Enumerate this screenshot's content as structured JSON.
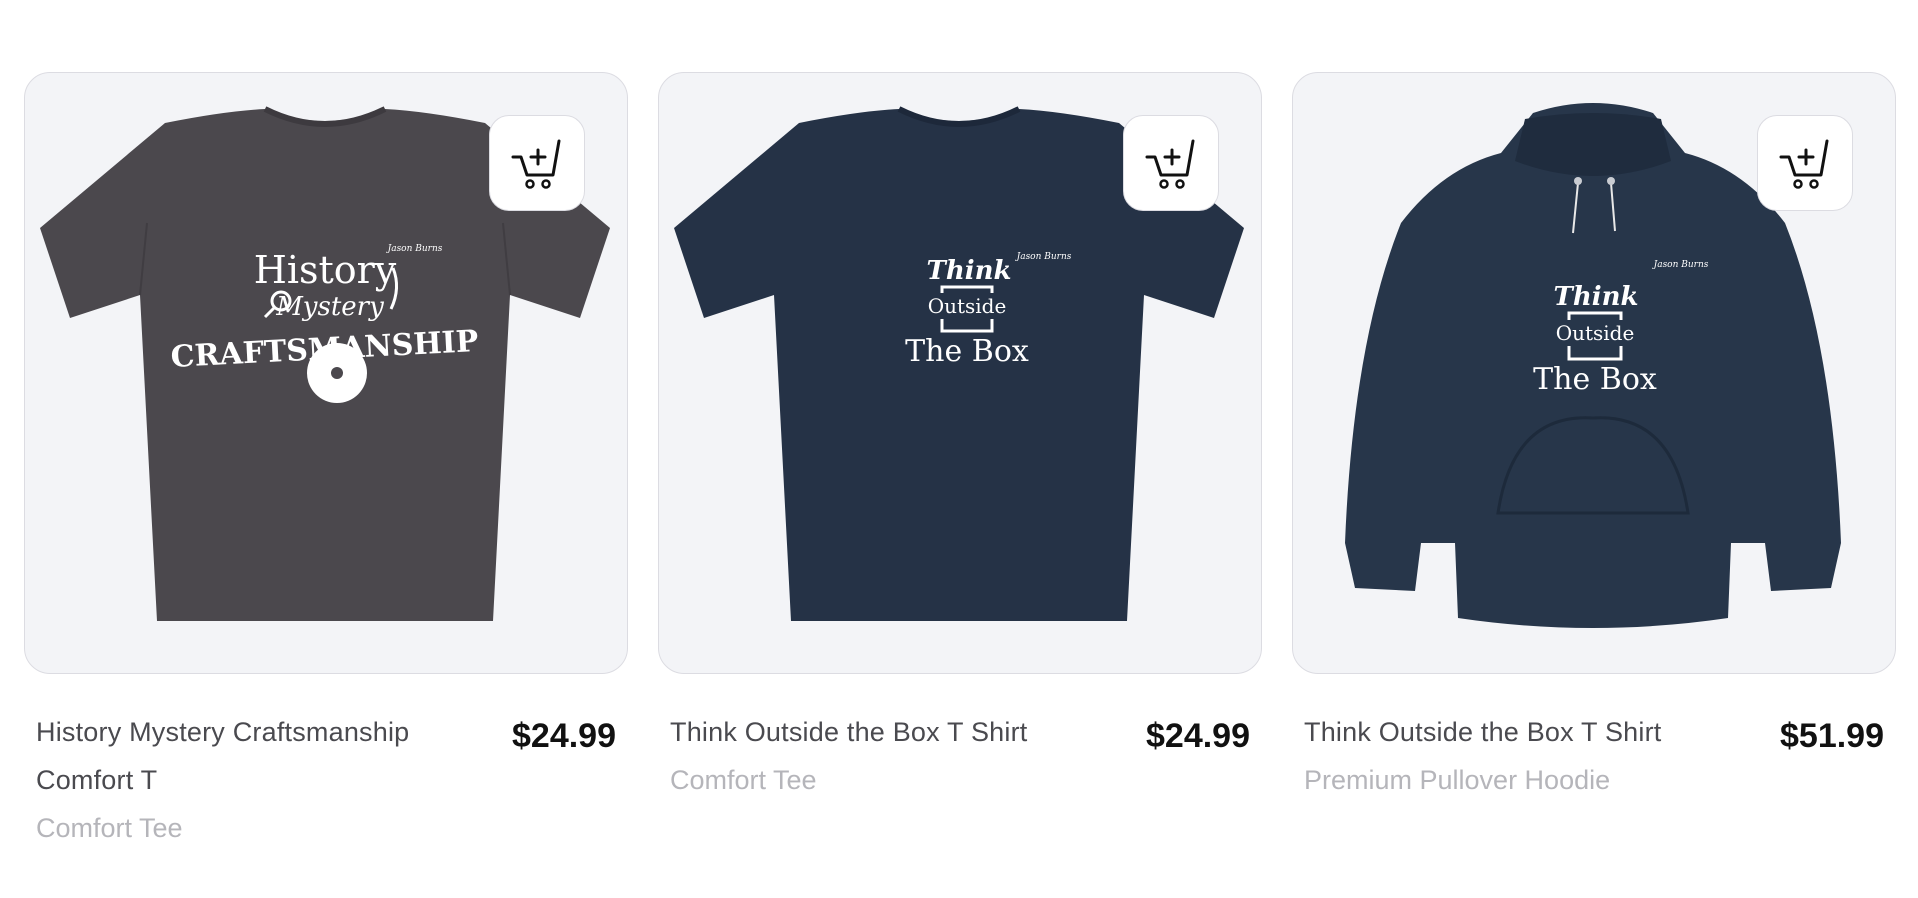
{
  "products": [
    {
      "name": "History Mystery Craftsmanship Comfort T",
      "style": "Comfort Tee",
      "price": "$24.99",
      "color": "#4b484d",
      "print": {
        "line1": "History",
        "line2": "Mystery",
        "line3": "CRAFTSMANSHIP",
        "signature": "Jason Burns"
      }
    },
    {
      "name": "Think Outside the Box T Shirt",
      "style": "Comfort Tee",
      "price": "$24.99",
      "color": "#253246",
      "print": {
        "line1": "Think",
        "line2": "Outside",
        "line3": "The Box",
        "signature": "Jason Burns"
      }
    },
    {
      "name": "Think Outside the Box T Shirt",
      "style": "Premium Pullover Hoodie",
      "price": "$51.99",
      "color": "#27364a",
      "print": {
        "line1": "Think",
        "line2": "Outside",
        "line3": "The Box",
        "signature": "Jason Burns"
      }
    }
  ],
  "icons": {
    "cart": "add-to-cart-icon"
  },
  "colors": {
    "card_bg": "#f3f4f7",
    "border": "#dcdce2",
    "price": "#111111",
    "name": "#4a4a4f",
    "subtitle": "#b5b5ba"
  }
}
